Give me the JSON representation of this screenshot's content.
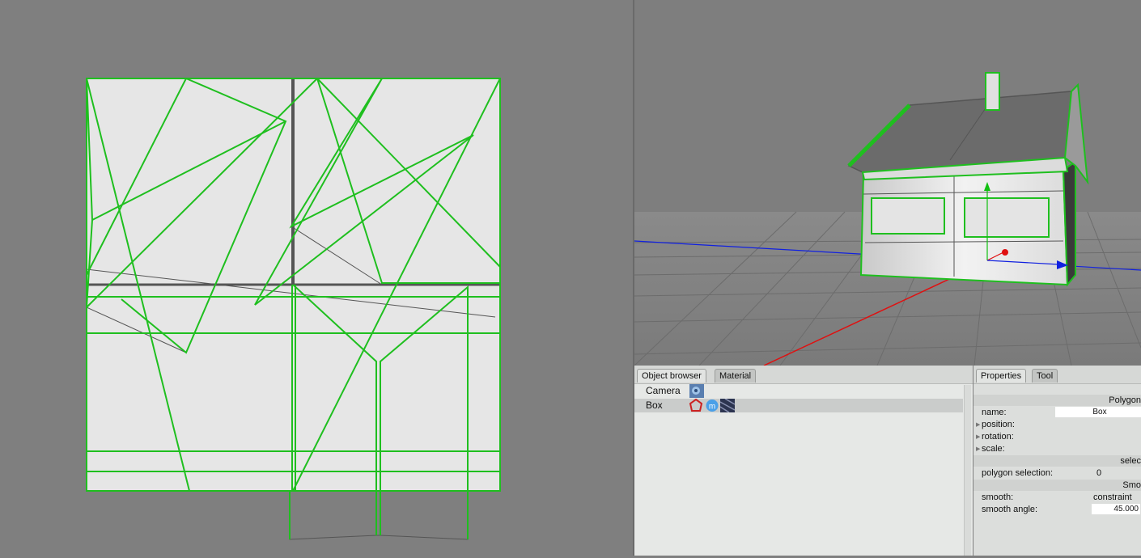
{
  "object_browser": {
    "tabs": [
      {
        "label": "Object browser",
        "active": true
      },
      {
        "label": "Material",
        "active": false
      }
    ],
    "items": [
      {
        "label": "Camera",
        "selected": false,
        "tags": [
          "camera-tag-icon"
        ]
      },
      {
        "label": "Box",
        "selected": true,
        "tags": [
          "phong-tag-icon",
          "material-tag-icon",
          "texture-tag-icon"
        ]
      }
    ]
  },
  "properties": {
    "tabs": [
      {
        "label": "Properties",
        "active": true
      },
      {
        "label": "Tool",
        "active": false
      }
    ],
    "section_polygon": "Polygon",
    "name_label": "name:",
    "name_value": "Box",
    "position_label": "position:",
    "rotation_label": "rotation:",
    "scale_label": "scale:",
    "section_selection": "selec",
    "polygon_selection_label": "polygon selection:",
    "polygon_selection_value": "0",
    "section_smooth": "Smo",
    "smooth_label": "smooth:",
    "smooth_value": "constraint",
    "smooth_angle_label": "smooth angle:",
    "smooth_angle_value": "45.000"
  },
  "colors": {
    "uv_edge_selected": "#1fbf1f",
    "uv_edge": "#555555",
    "axis_x": "#e01010",
    "axis_y": "#10c010",
    "axis_z": "#1020e0"
  }
}
